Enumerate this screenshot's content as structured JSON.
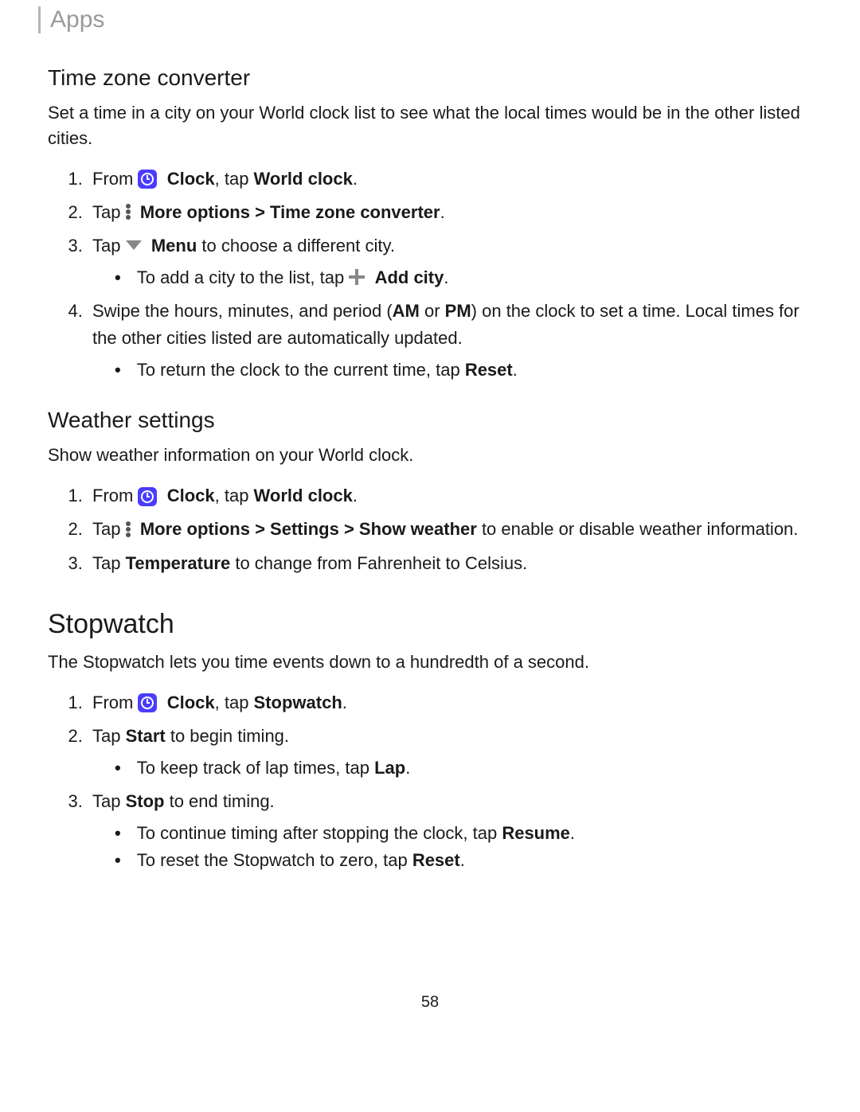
{
  "breadcrumb": "Apps",
  "page_number": "58",
  "sections": {
    "tz": {
      "heading": "Time zone converter",
      "intro": "Set a time in a city on your World clock list to see what the local times would be in the other listed cities.",
      "step1_pre": "From ",
      "clock_label": "Clock",
      "step1_post": ", tap ",
      "world_clock": "World clock",
      "step2_pre": "Tap ",
      "more_options": "More options",
      "sep": " > ",
      "tz_converter": "Time zone converter",
      "step3_pre": "Tap ",
      "menu_label": "Menu",
      "step3_post": " to choose a different city.",
      "bullet_add_pre": "To add a city to the list, tap ",
      "add_city": "Add city",
      "step4": "Swipe the hours, minutes, and period (",
      "am": "AM",
      "or": " or ",
      "pm": "PM",
      "step4_post": ") on the clock to set a time. Local times for the other cities listed are automatically updated.",
      "bullet_reset_pre": "To return the clock to the current time, tap ",
      "reset": "Reset"
    },
    "weather": {
      "heading": "Weather settings",
      "intro": "Show weather information on your World clock.",
      "step1_pre": "From ",
      "clock_label": "Clock",
      "step1_post": ", tap ",
      "world_clock": "World clock",
      "step2_pre": "Tap ",
      "more_options": "More options",
      "sep1": " > ",
      "settings": "Settings",
      "sep2": " > ",
      "show_weather": "Show weather",
      "step2_post": " to enable or disable weather information.",
      "step3_pre": "Tap ",
      "temperature": "Temperature",
      "step3_post": " to change from Fahrenheit to Celsius."
    },
    "stopwatch": {
      "heading": "Stopwatch",
      "intro": "The Stopwatch lets you time events down to a hundredth of a second.",
      "step1_pre": "From ",
      "clock_label": "Clock",
      "step1_post": ", tap ",
      "stopwatch_tab": "Stopwatch",
      "step2_pre": "Tap ",
      "start": "Start",
      "step2_post": " to begin timing.",
      "bullet_lap_pre": "To keep track of lap times, tap ",
      "lap": "Lap",
      "step3_pre": "Tap ",
      "stop": "Stop",
      "step3_post": " to end timing.",
      "bullet_resume_pre": "To continue timing after stopping the clock, tap ",
      "resume": "Resume",
      "bullet_reset_pre": "To reset the Stopwatch to zero, tap ",
      "reset": "Reset"
    }
  }
}
